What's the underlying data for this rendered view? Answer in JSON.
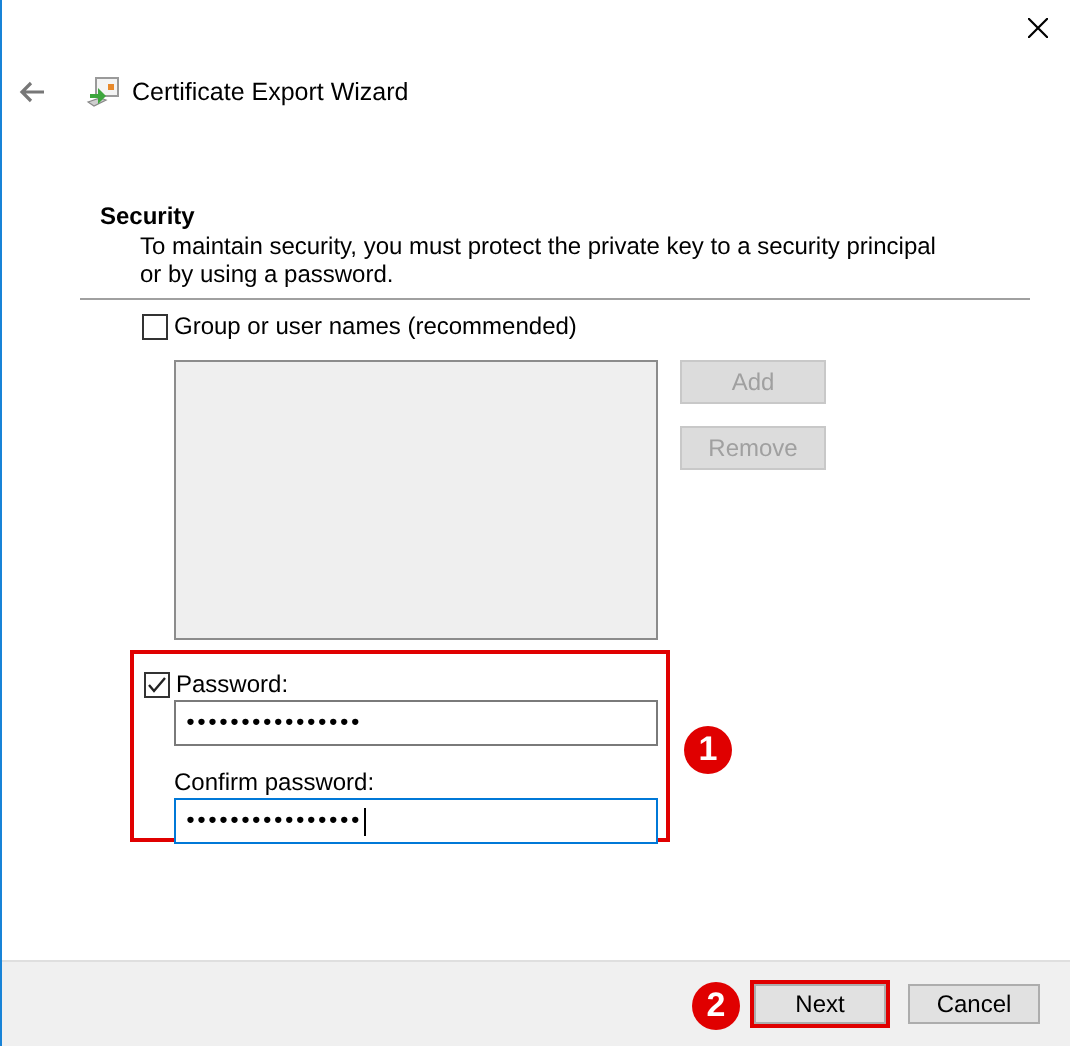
{
  "header": {
    "title": "Certificate Export Wizard"
  },
  "section": {
    "heading": "Security",
    "description": "To maintain security, you must protect the private key to a security principal or by using a password."
  },
  "group_option": {
    "label": "Group or user names (recommended)",
    "checked": false
  },
  "principal_buttons": [
    {
      "label": "Add",
      "disabled": true
    },
    {
      "label": "Remove",
      "disabled": true
    }
  ],
  "password_group": {
    "highlighted": true,
    "badge": "1"
  },
  "password_option": {
    "label": "Password:",
    "checked": true
  },
  "password_field": {
    "value": "••••••••••••••••",
    "focused": false
  },
  "confirm_field": {
    "label": "Confirm password:",
    "value": "••••••••••••••••",
    "focused": true
  },
  "buttons": [
    {
      "label": "Next",
      "highlighted": true,
      "badge": "2"
    },
    {
      "label": "Cancel",
      "highlighted": false
    }
  ]
}
